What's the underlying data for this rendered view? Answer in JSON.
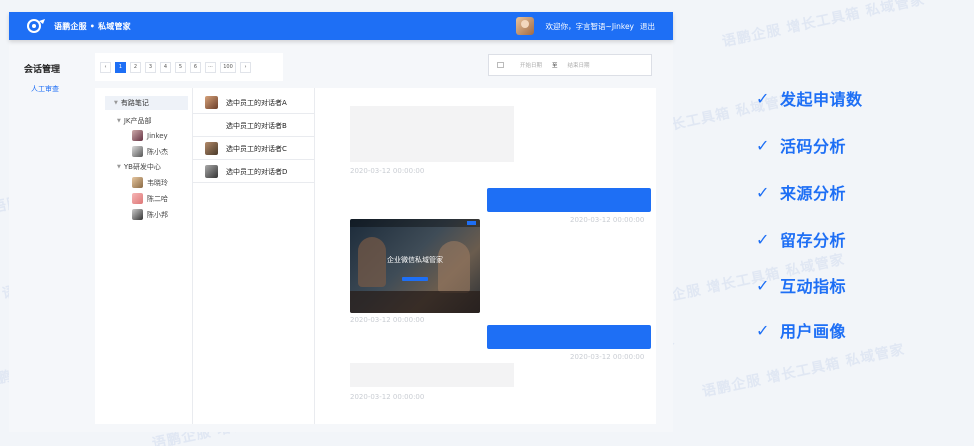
{
  "header": {
    "brand": "语鹏企服 • 私域管家",
    "welcome": "欢迎你，字言智语~Jinkey",
    "logout": "退出"
  },
  "sidebar": {
    "title": "会话管理",
    "items": [
      {
        "label": "人工审查"
      }
    ]
  },
  "pagination": {
    "prev": "‹",
    "pages": [
      "1",
      "2",
      "3",
      "4",
      "5",
      "6",
      "···",
      "100"
    ],
    "active": "1",
    "next": "›"
  },
  "date_range": {
    "start_placeholder": "开始日期",
    "separator": "至",
    "end_placeholder": "结束日期"
  },
  "tree": {
    "root": "有路笔记",
    "groups": [
      {
        "name": "JK产品部",
        "members": [
          "Jinkey",
          "陈小杰"
        ]
      },
      {
        "name": "YB研发中心",
        "members": [
          "韦晓玲",
          "陈二哈",
          "陈小邦"
        ]
      }
    ]
  },
  "conversations": [
    {
      "label": "选中员工的对话者A"
    },
    {
      "label": "选中员工的对话者B"
    },
    {
      "label": "选中员工的对话者C"
    },
    {
      "label": "选中员工的对话者D"
    }
  ],
  "chat": {
    "timestamps": [
      "2020-03-12 00:00:00",
      "2020-03-12 00:00:00",
      "2020-03-12 00:00:00",
      "2020-03-12 00:00:00",
      "2020-03-12 00:00:00"
    ],
    "image_title": "企业微信私域管家"
  },
  "features": [
    {
      "check": "✓",
      "label": "发起申请数"
    },
    {
      "check": "✓",
      "label": "活码分析"
    },
    {
      "check": "✓",
      "label": "来源分析"
    },
    {
      "check": "✓",
      "label": "留存分析"
    },
    {
      "check": "✓",
      "label": "互动指标"
    },
    {
      "check": "✓",
      "label": "用户画像"
    }
  ],
  "watermark": "语鹏企服 增长工具箱 私域管家",
  "colors": {
    "accent": "#1e6ff5",
    "background": "#f2f5f9"
  }
}
